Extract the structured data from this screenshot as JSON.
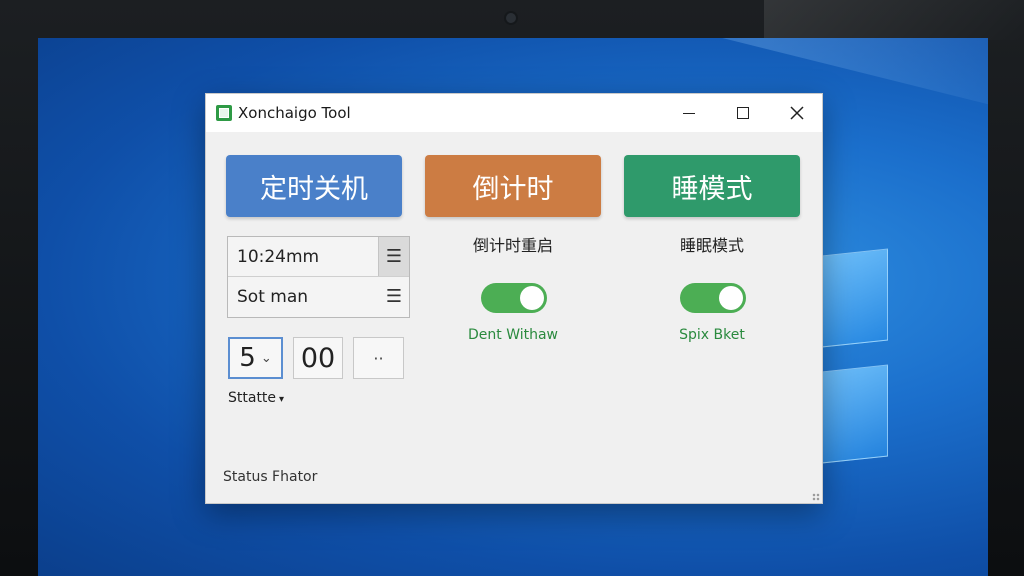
{
  "window": {
    "title": "Xonchaigo Tool",
    "controls": {
      "minimize_icon": "minimize-icon",
      "maximize_icon": "maximize-icon",
      "close_icon": "close-icon"
    }
  },
  "modes": [
    {
      "label": "定时关机",
      "color": "#4a80c9"
    },
    {
      "label": "倒计时",
      "color": "#cc7c43"
    },
    {
      "label": "睡模式",
      "color": "#2f9a6b"
    }
  ],
  "time_list": [
    {
      "text": "10:24mm",
      "icon": "list-icon"
    },
    {
      "text": "Sot man",
      "icon": "list-icon"
    }
  ],
  "spinners": {
    "hours": "5",
    "minutes": "00",
    "more": "··"
  },
  "state_dropdown": {
    "label": "Sttatte"
  },
  "countdown": {
    "caption": "倒计时重启",
    "toggle_on": true,
    "toggle_label": "Dent Withaw"
  },
  "sleep": {
    "caption": "睡眠模式",
    "toggle_on": true,
    "toggle_label": "Spix Bket"
  },
  "status_bar": {
    "text": "Status Fhator"
  },
  "colors": {
    "toggle_on": "#4cae54",
    "toggle_label": "#2a8a3e",
    "focus": "#5b8ed1"
  }
}
